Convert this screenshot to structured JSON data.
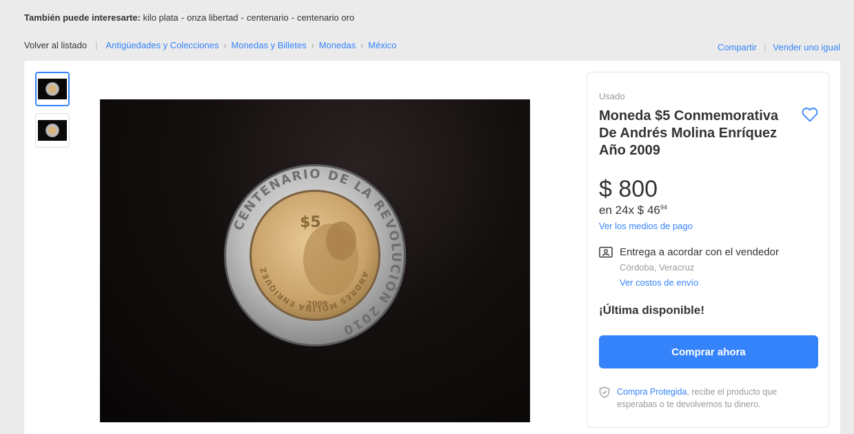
{
  "related": {
    "label": "También puede interesarte:",
    "items": [
      "kilo plata",
      "onza libertad",
      "centenario",
      "centenario oro"
    ]
  },
  "breadcrumb": {
    "back": "Volver al listado",
    "items": [
      "Antigüedades y Colecciones",
      "Monedas y Billetes",
      "Monedas",
      "México"
    ]
  },
  "actions": {
    "share": "Compartir",
    "sell_same": "Vender uno igual"
  },
  "product": {
    "condition": "Usado",
    "title": "Moneda $5 Conmemorativa De Andrés Molina Enríquez Año 2009",
    "price": "$ 800",
    "installments_prefix": "en 24x $ 46",
    "installments_cents": "94",
    "payment_link": "Ver los medios de pago",
    "shipping": "Entrega a acordar con el vendedor",
    "location": "Córdoba, Veracruz",
    "shipping_cost_link": "Ver costos de envío",
    "stock": "¡Última disponible!",
    "buy_button": "Comprar ahora",
    "protection_link": "Compra Protegida",
    "protection_text": ", recibe el producto que esperabas o te devolvemos tu dinero."
  },
  "coin_text": {
    "outer": "CENTENARIO DE LA REVOLUCIÓN 2010",
    "inner": "ANDRÉS MOLINA ENRÍQUEZ",
    "year": "2009",
    "denomination": "$5"
  },
  "colors": {
    "accent": "#3483fa",
    "background": "#ebebeb"
  },
  "icons": [
    "heart-icon",
    "user-card-icon",
    "shield-icon",
    "chevron-right-icon"
  ]
}
